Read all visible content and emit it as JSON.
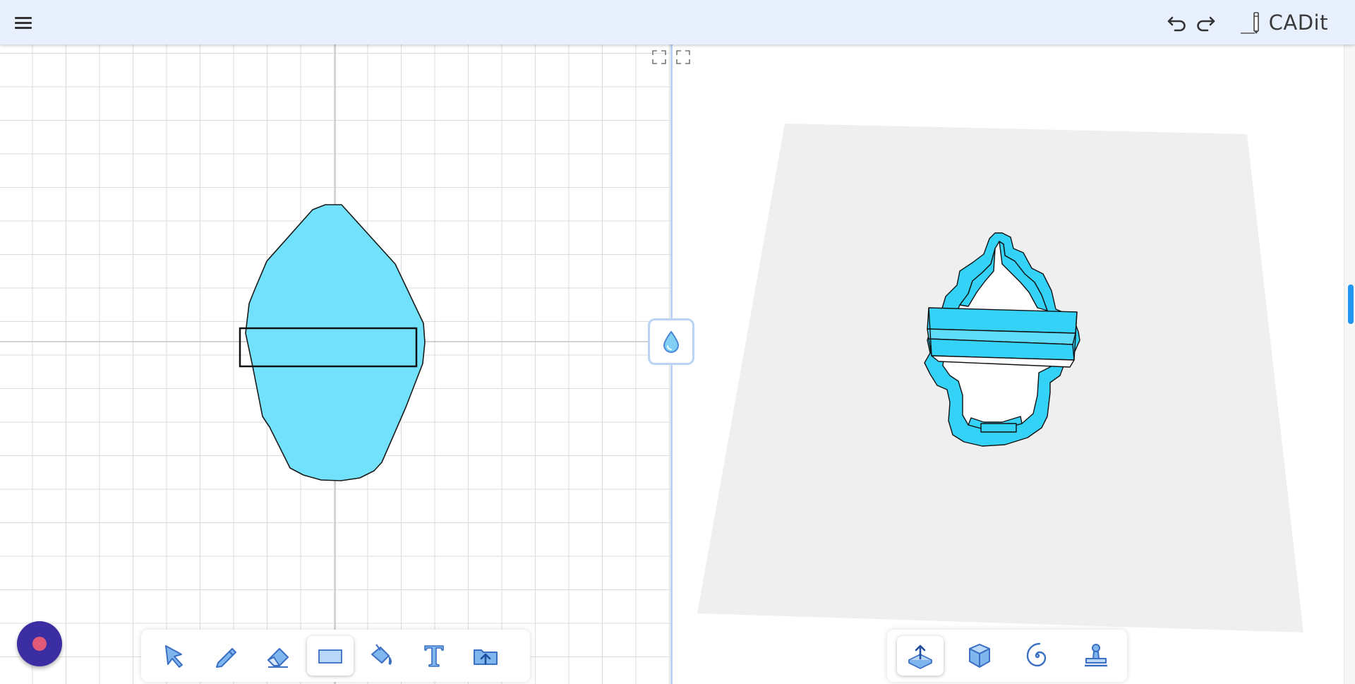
{
  "app": {
    "name": "CADit"
  },
  "topbar": {
    "menu_icon": "hamburger-menu-icon",
    "undo_icon": "undo-icon",
    "redo_icon": "redo-icon",
    "logo_icon": "pencil-logo-icon"
  },
  "colors": {
    "topbar_bg": "#e8f0fe",
    "shape_fill": "#72e1fb",
    "model_fill": "#35d2f7",
    "accent": "#2196f3",
    "tool_icon": "#4a86d8",
    "fab_bg": "#3b2ea3",
    "fab_dot": "#e05a78",
    "splitter": "#bcd3f3",
    "build_plate": "#efefef"
  },
  "drawing_tools": [
    {
      "name": "select-tool",
      "icon": "cursor-arrow-icon",
      "active": false
    },
    {
      "name": "pencil-tool",
      "icon": "pencil-icon",
      "active": false
    },
    {
      "name": "eraser-tool",
      "icon": "eraser-icon",
      "active": false
    },
    {
      "name": "rectangle-tool",
      "icon": "rectangle-icon",
      "active": true
    },
    {
      "name": "fill-tool",
      "icon": "paint-bucket-icon",
      "active": false
    },
    {
      "name": "text-tool",
      "icon": "text-t-icon",
      "active": false
    },
    {
      "name": "import-tool",
      "icon": "folder-upload-icon",
      "active": false
    }
  ],
  "model_tools": [
    {
      "name": "extrude-tool",
      "icon": "extrude-up-icon",
      "active": true
    },
    {
      "name": "box-tool",
      "icon": "cube-icon",
      "active": false
    },
    {
      "name": "spiral-tool",
      "icon": "spiral-icon",
      "active": false
    },
    {
      "name": "stamp-tool",
      "icon": "stamp-icon",
      "active": false
    }
  ],
  "splitter": {
    "handle_icon": "water-drop-icon"
  },
  "fullscreen_buttons": [
    "fullscreen-left-icon",
    "fullscreen-right-icon"
  ]
}
